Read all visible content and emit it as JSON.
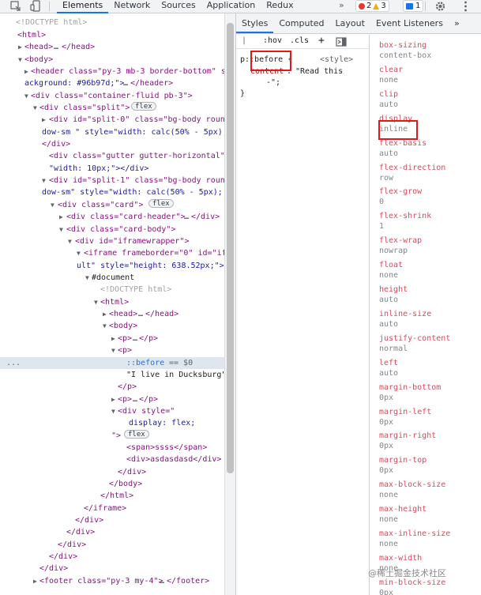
{
  "toolbar": {
    "tabs": [
      "Elements",
      "Network",
      "Sources",
      "Application",
      "Redux"
    ],
    "active_tab": "Elements",
    "more": "»",
    "errors": "2",
    "warnings": "3",
    "messages": "1"
  },
  "dom": {
    "doctype": "<!DOCTYPE html>",
    "html_open": "<html>",
    "head": "<head>",
    "head_close": "</head>",
    "body_open": "<body>",
    "header_1": "<header class=\"py-3 mb-3 border-bottom\" s",
    "header_2": "ackground: #96b97d;\">",
    "header_close": "</header>",
    "container": "<div class=\"container-fluid pb-3\">",
    "split": "<div class=\"split\">",
    "flex": "flex",
    "split0_1": "<div id=\"split-0\" class=\"bg-body roun",
    "split0_2": "dow-sm \" style=\"width: calc(50% - 5px);",
    "div_close": "</div>",
    "gutter_1": "<div class=\"gutter gutter-horizontal\"",
    "gutter_2": "\"width: 10px;\"></div>",
    "split1_1": "<div id=\"split-1\" class=\"bg-body roun",
    "split1_2": "dow-sm\" style=\"width: calc(50% - 5px);'",
    "card": "<div class=\"card\">",
    "card_header": "<div class=\"card-header\">",
    "card_body": "<div class=\"card-body\">",
    "iframewrapper": "<div id=\"iframewrapper\">",
    "iframe_1": "<iframe frameborder=\"0\" id=\"if",
    "iframe_2": "ult\" style=\"height: 638.52px;\">",
    "document": "#document",
    "inner_doctype": "<!DOCTYPE html>",
    "inner_html": "<html>",
    "inner_head": "<head>",
    "inner_head_close": "</head>",
    "inner_body": "<body>",
    "p_collapsed": "<p>",
    "p_close": "</p>",
    "p_open": "<p>",
    "before": "::before",
    "eq_ref": "== $0",
    "p_text": "\"I live in Ducksburg\"",
    "div_style_1": "<div style=\"",
    "div_style_2": "display: flex;",
    "div_style_3": "\">",
    "span": "<span>ssss</span>",
    "inner_div": "<div>asdasdasd</div>",
    "body_close": "</body>",
    "html_close": "</html>",
    "iframe_close": "</iframe>",
    "footer": "<footer class=\"py-3 my-4\">",
    "footer_close": "</footer>",
    "ellipsis": "…",
    "row_dots": "..."
  },
  "styles_panel": {
    "subtabs": [
      "Styles",
      "Computed",
      "Layout",
      "Event Listeners"
    ],
    "more": "»",
    "hov": ":hov",
    "cls": ".cls",
    "plus": "+",
    "selector": "p::before {",
    "source": "<style>",
    "prop": "content",
    "value": "\"Read this",
    "value_cont": "-\";",
    "close": "}"
  },
  "computed": [
    {
      "name": "box-sizing",
      "value": "content-box"
    },
    {
      "name": "clear",
      "value": "none"
    },
    {
      "name": "clip",
      "value": "auto"
    },
    {
      "name": "display",
      "value": "inline"
    },
    {
      "name": "flex-basis",
      "value": "auto"
    },
    {
      "name": "flex-direction",
      "value": "row"
    },
    {
      "name": "flex-grow",
      "value": "0"
    },
    {
      "name": "flex-shrink",
      "value": "1"
    },
    {
      "name": "flex-wrap",
      "value": "nowrap"
    },
    {
      "name": "float",
      "value": "none"
    },
    {
      "name": "height",
      "value": "auto"
    },
    {
      "name": "inline-size",
      "value": "auto"
    },
    {
      "name": "justify-content",
      "value": "normal"
    },
    {
      "name": "left",
      "value": "auto"
    },
    {
      "name": "margin-bottom",
      "value": "0px"
    },
    {
      "name": "margin-left",
      "value": "0px"
    },
    {
      "name": "margin-right",
      "value": "0px"
    },
    {
      "name": "margin-top",
      "value": "0px"
    },
    {
      "name": "max-block-size",
      "value": "none"
    },
    {
      "name": "max-height",
      "value": "none"
    },
    {
      "name": "max-inline-size",
      "value": "none"
    },
    {
      "name": "max-width",
      "value": "none"
    },
    {
      "name": "min-block-size",
      "value": "0px"
    }
  ],
  "watermark": "@稀土掘金技术社区",
  "colors": {
    "highlight_box": "#e0191d",
    "accent": "#1a73e8",
    "selected_row": "#dfe6ee"
  }
}
